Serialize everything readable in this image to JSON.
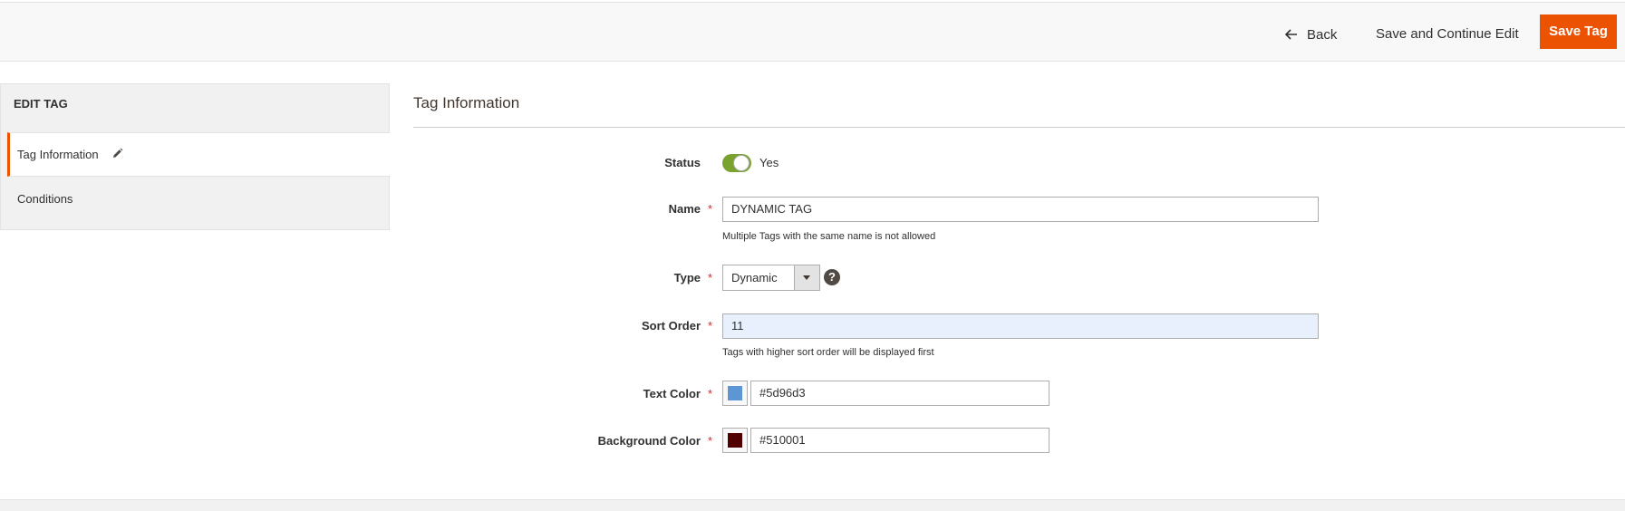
{
  "toolbar": {
    "back_label": "Back",
    "save_continue_label": "Save and Continue Edit",
    "save_label": "Save Tag",
    "accent_color": "#eb5202"
  },
  "sidebar": {
    "title": "EDIT TAG",
    "items": [
      {
        "label": "Tag Information",
        "active": true,
        "icon": "pencil-icon"
      },
      {
        "label": "Conditions",
        "active": false
      }
    ]
  },
  "main": {
    "section_title": "Tag Information",
    "fields": {
      "status": {
        "label": "Status",
        "value": "Yes",
        "enabled": true
      },
      "name": {
        "label": "Name",
        "value": "DYNAMIC TAG",
        "hint": "Multiple Tags with the same name is not allowed"
      },
      "type": {
        "label": "Type",
        "value": "Dynamic",
        "help_icon": "question-icon"
      },
      "sort_order": {
        "label": "Sort Order",
        "value": "11",
        "hint": "Tags with higher sort order will be displayed first"
      },
      "text_color": {
        "label": "Text Color",
        "value": "#5d96d3",
        "swatch": "#5d96d3"
      },
      "background_color": {
        "label": "Background Color",
        "value": "#510001",
        "swatch": "#510001"
      }
    },
    "required_marker": "*"
  }
}
